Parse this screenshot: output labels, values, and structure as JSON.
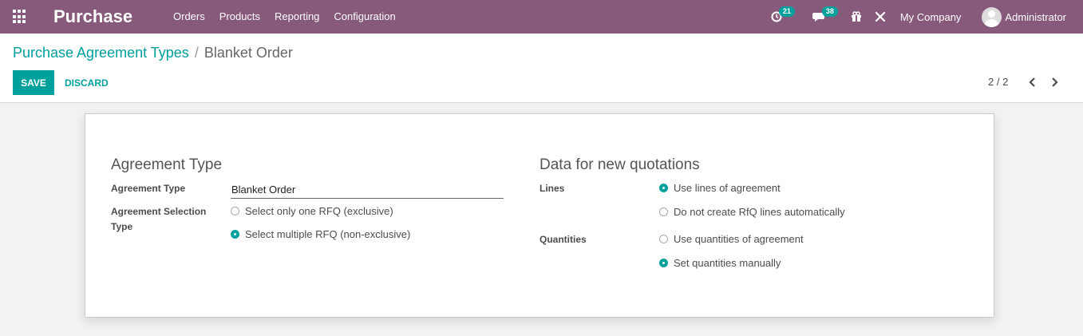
{
  "navbar": {
    "app_name": "Purchase",
    "menu": [
      "Orders",
      "Products",
      "Reporting",
      "Configuration"
    ],
    "activity_count": "21",
    "message_count": "38",
    "company": "My Company",
    "user": "Administrator"
  },
  "breadcrumb": {
    "parent": "Purchase Agreement Types",
    "separator": "/",
    "current": "Blanket Order"
  },
  "buttons": {
    "save": "SAVE",
    "discard": "DISCARD"
  },
  "pager": {
    "value": "2 / 2"
  },
  "form": {
    "left_group": {
      "title": "Agreement Type",
      "agreement_type_label": "Agreement Type",
      "agreement_type_value": "Blanket Order",
      "selection_type_label_line1": "Agreement Selection",
      "selection_type_label_line2": "Type",
      "selection_options": [
        {
          "label": "Select only one RFQ (exclusive)",
          "checked": false
        },
        {
          "label": "Select multiple RFQ (non-exclusive)",
          "checked": true
        }
      ]
    },
    "right_group": {
      "title": "Data for new quotations",
      "lines_label": "Lines",
      "lines_options": [
        {
          "label": "Use lines of agreement",
          "checked": true
        },
        {
          "label": "Do not create RfQ lines automatically",
          "checked": false
        }
      ],
      "quantities_label": "Quantities",
      "quantities_options": [
        {
          "label": "Use quantities of agreement",
          "checked": false
        },
        {
          "label": "Set quantities manually",
          "checked": true
        }
      ]
    }
  },
  "colors": {
    "navbar": "#875a7b",
    "accent": "#00a09d"
  }
}
